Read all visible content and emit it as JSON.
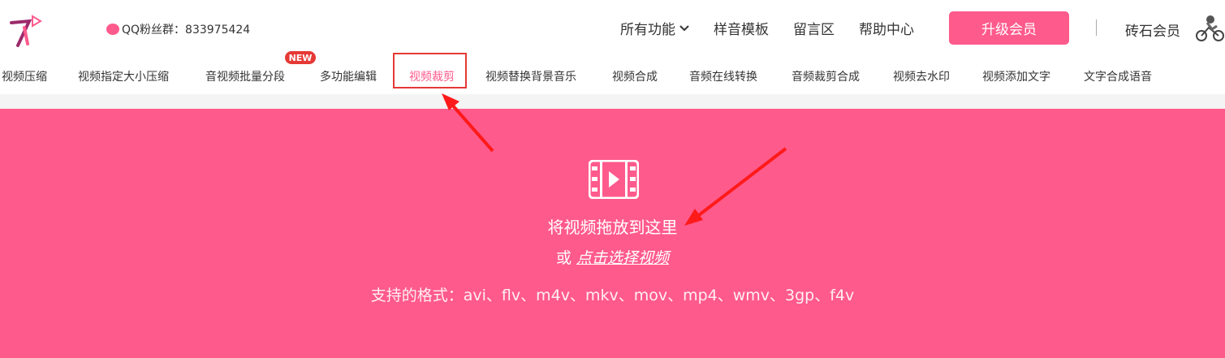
{
  "header": {
    "qq_group": "QQ粉丝群：833975424",
    "nav": [
      {
        "label": "所有功能",
        "has_dropdown": true
      },
      {
        "label": "样音模板"
      },
      {
        "label": "留言区"
      },
      {
        "label": "帮助中心"
      }
    ],
    "upgrade_label": "升级会员",
    "member_label": "砖石会员",
    "brand_color": "#ff5a8c"
  },
  "subnav": {
    "items": [
      {
        "label": "视频压缩"
      },
      {
        "label": "视频指定大小压缩"
      },
      {
        "label": "音视频批量分段"
      },
      {
        "label": "多功能编辑"
      },
      {
        "label": "视频裁剪",
        "active": true
      },
      {
        "label": "视频替换背景音乐"
      },
      {
        "label": "视频合成"
      },
      {
        "label": "音频在线转换"
      },
      {
        "label": "音频裁剪合成"
      },
      {
        "label": "视频去水印"
      },
      {
        "label": "视频添加文字"
      },
      {
        "label": "文字合成语音"
      }
    ],
    "new_badge": "NEW"
  },
  "dropzone": {
    "title": "将视频拖放到这里",
    "or_text": "或",
    "choose_link": "点击选择视频",
    "formats": "支持的格式：avi、flv、m4v、mkv、mov、mp4、wmv、3gp、f4v"
  }
}
